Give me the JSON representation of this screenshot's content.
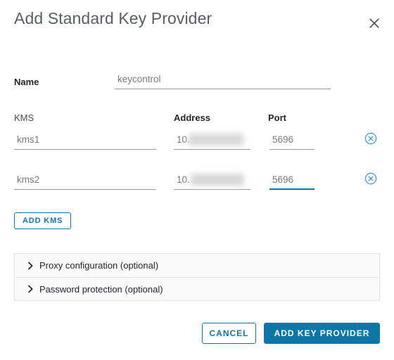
{
  "dialog": {
    "title": "Add Standard Key Provider",
    "close_icon": "close-icon"
  },
  "name_field": {
    "label": "Name",
    "value": "keycontrol",
    "placeholder": "Name"
  },
  "kms_table": {
    "headers": {
      "kms": "KMS",
      "address": "Address",
      "port": "Port"
    },
    "rows": [
      {
        "kms": "kms1",
        "address": "10.",
        "address_redacted": true,
        "port": "5696",
        "port_focused": false,
        "delete_icon": "delete-circle-icon"
      },
      {
        "kms": "kms2",
        "address": "10.",
        "address_redacted": true,
        "port": "5696",
        "port_focused": true,
        "delete_icon": "delete-circle-icon"
      }
    ]
  },
  "add_kms_button": {
    "label": "ADD KMS"
  },
  "accordions": [
    {
      "label": "Proxy configuration (optional)",
      "icon": "chevron-right-icon",
      "expanded": false
    },
    {
      "label": "Password protection (optional)",
      "icon": "chevron-right-icon",
      "expanded": false
    }
  ],
  "footer": {
    "cancel_label": "CANCEL",
    "submit_label": "ADD KEY PROVIDER"
  },
  "colors": {
    "accent": "#0f76a8",
    "title_text": "#565e67",
    "body_text": "#21252b",
    "field_text": "#73797e",
    "field_underline": "#9a9a9a",
    "panel_bg": "#fafafa",
    "panel_border": "#e3e3e3"
  }
}
